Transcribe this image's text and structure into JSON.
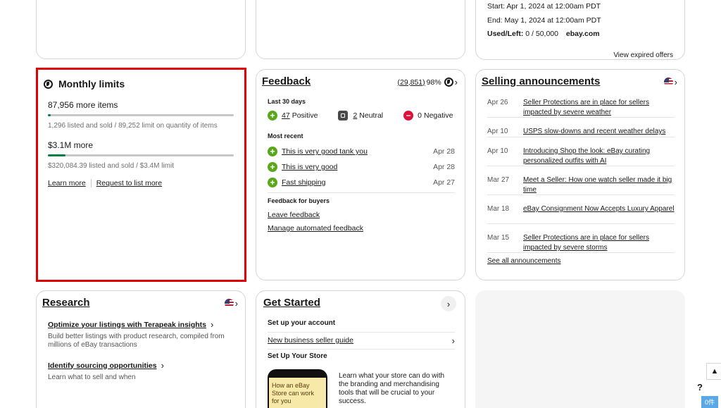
{
  "offers_card": {
    "start": "Start: Apr 1, 2024 at 12:00am PDT",
    "end": "End: May 1, 2024 at 12:00am PDT",
    "used_label": "Used/Left:",
    "used_value": "0  / 50,000",
    "site": "ebay.com",
    "view_expired": "View expired offers"
  },
  "monthly_limits": {
    "title": "Monthly limits",
    "items_more": "87,956 more items",
    "items_detail": "1,296 listed and sold /  89,252 limit on quantity of items",
    "items_fraction": 0.0145,
    "amount_more": "$3.1M more",
    "amount_detail": "$320,084.39 listed and sold /  $3.4M limit",
    "amount_fraction": 0.094,
    "learn_more": "Learn more",
    "request": "Request to list more"
  },
  "feedback": {
    "title": "Feedback",
    "count": "(29,851)",
    "percent": "98%",
    "last30": "Last 30 days",
    "positive_count": "47",
    "positive_label": "Positive",
    "neutral_count": "2",
    "neutral_label": "Neutral",
    "negative_count": "0",
    "negative_label": "Negative",
    "most_recent": "Most recent",
    "recent": [
      {
        "text": "This is very good tank you",
        "date": "Apr 28"
      },
      {
        "text": "This is very good",
        "date": "Apr 28"
      },
      {
        "text": "Fast shipping",
        "date": "Apr 27"
      }
    ],
    "buyers_heading": "Feedback for buyers",
    "leave": "Leave feedback",
    "manage": "Manage automated feedback"
  },
  "announcements": {
    "title": "Selling announcements",
    "items": [
      {
        "date": "Apr 26",
        "text": "Seller Protections are in place for sellers impacted by severe weather"
      },
      {
        "date": "Apr 10",
        "text": "USPS slow-downs and recent weather delays"
      },
      {
        "date": "Apr 10",
        "text": "Introducing Shop the look: eBay curating personalized outfits with AI"
      },
      {
        "date": "Mar 27",
        "text": "Meet a Seller: How one watch seller made it big time"
      },
      {
        "date": "Mar 18",
        "text": "eBay Consignment Now Accepts Luxury Apparel"
      },
      {
        "date": "Mar 15",
        "text": "Seller Protections are in place for sellers impacted by severe storms"
      }
    ],
    "see_all": "See all announcements"
  },
  "research": {
    "title": "Research",
    "link1": "Optimize your listings with Terapeak insights",
    "desc1": "Build better listings with product research, compiled from millions of eBay transactions",
    "link2": "Identify sourcing opportunities",
    "desc2": "Learn what to sell and when"
  },
  "get_started": {
    "title": "Get Started",
    "setup_account": "Set up your account",
    "new_guide": "New business seller guide",
    "setup_store": "Set Up Your Store",
    "promo_text": "How an eBay Store can work for you",
    "store_desc": "Learn what your store can do with the branding and merchandising tools that will be crucial to your success."
  },
  "floating": {
    "help": "?",
    "cart_badge": "0件"
  },
  "colors": {
    "highlight_border": "#e00000",
    "positive": "#5ba71b",
    "negative": "#e0103a",
    "progress": "#05823f"
  }
}
